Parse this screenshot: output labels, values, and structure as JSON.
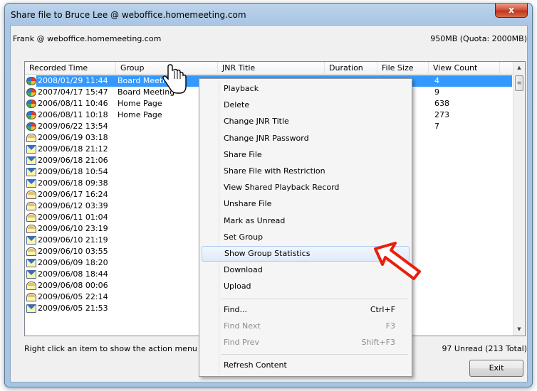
{
  "window": {
    "title": "Share file to Bruce Lee @ weboffice.homemeeting.com",
    "close_label": "x"
  },
  "header": {
    "user": "Frank @ weboffice.homemeeting.com",
    "quota": "950MB (Quota: 2000MB)"
  },
  "list": {
    "columns": [
      "Recorded Time",
      "Group",
      "JNR Title",
      "Duration",
      "File Size",
      "View Count"
    ],
    "rows": [
      {
        "time": "2008/01/29 11:44",
        "group": "Board Meetin",
        "views": "4",
        "icon": "color-icon",
        "selected": true
      },
      {
        "time": "2007/04/17 15:47",
        "group": "Board Meeting",
        "views": "9",
        "icon": "color-icon"
      },
      {
        "time": "2006/08/11 10:46",
        "group": "Home Page",
        "views": "638",
        "icon": "color-icon"
      },
      {
        "time": "2006/08/11 10:18",
        "group": "Home Page",
        "views": "273",
        "icon": "color-icon"
      },
      {
        "time": "2009/06/22 13:54",
        "group": "",
        "views": "7",
        "icon": "color-icon"
      },
      {
        "time": "2009/06/19 03:18",
        "group": "",
        "views": "",
        "icon": "open-envelope-icon"
      },
      {
        "time": "2009/06/18 21:12",
        "group": "",
        "views": "",
        "icon": "envelope-icon"
      },
      {
        "time": "2009/06/18 21:06",
        "group": "",
        "views": "",
        "icon": "envelope-icon"
      },
      {
        "time": "2009/06/18 10:54",
        "group": "",
        "views": "",
        "icon": "envelope-icon"
      },
      {
        "time": "2009/06/18 09:38",
        "group": "",
        "views": "",
        "icon": "envelope-icon"
      },
      {
        "time": "2009/06/17 16:24",
        "group": "",
        "views": "",
        "icon": "open-envelope-icon"
      },
      {
        "time": "2009/06/12 03:39",
        "group": "",
        "views": "",
        "icon": "open-envelope-icon"
      },
      {
        "time": "2009/06/11 01:04",
        "group": "",
        "views": "",
        "icon": "open-envelope-icon"
      },
      {
        "time": "2009/06/10 23:19",
        "group": "",
        "views": "",
        "icon": "open-envelope-icon"
      },
      {
        "time": "2009/06/10 21:19",
        "group": "",
        "views": "",
        "icon": "envelope-icon"
      },
      {
        "time": "2009/06/10 03:55",
        "group": "",
        "views": "",
        "icon": "open-envelope-icon"
      },
      {
        "time": "2009/06/09 18:20",
        "group": "",
        "views": "",
        "icon": "envelope-icon"
      },
      {
        "time": "2009/06/08 18:44",
        "group": "",
        "views": "",
        "icon": "envelope-icon"
      },
      {
        "time": "2009/06/08 00:06",
        "group": "",
        "views": "",
        "icon": "open-envelope-icon"
      },
      {
        "time": "2009/06/05 22:14",
        "group": "",
        "views": "",
        "icon": "open-envelope-icon"
      },
      {
        "time": "2009/06/05 21:53",
        "group": "",
        "views": "",
        "icon": "envelope-icon"
      }
    ]
  },
  "context_menu": {
    "items": [
      {
        "label": "Playback",
        "shortcut": ""
      },
      {
        "label": "Delete",
        "shortcut": ""
      },
      {
        "label": "Change JNR Title",
        "shortcut": ""
      },
      {
        "label": "Change JNR Password",
        "shortcut": ""
      },
      {
        "label": "Share File",
        "shortcut": ""
      },
      {
        "label": "Share File with Restriction",
        "shortcut": ""
      },
      {
        "label": "View Shared Playback Record",
        "shortcut": ""
      },
      {
        "label": "Unshare File",
        "shortcut": ""
      },
      {
        "label": "Mark as Unread",
        "shortcut": ""
      },
      {
        "label": "Set Group",
        "shortcut": ""
      },
      {
        "label": "Show Group Statistics",
        "shortcut": "",
        "highlighted": true
      },
      {
        "label": "Download",
        "shortcut": ""
      },
      {
        "label": "Upload",
        "shortcut": ""
      },
      {
        "separator": true
      },
      {
        "label": "Find...",
        "shortcut": "Ctrl+F"
      },
      {
        "label": "Find Next",
        "shortcut": "F3",
        "disabled": true
      },
      {
        "label": "Find Prev",
        "shortcut": "Shift+F3",
        "disabled": true
      },
      {
        "separator": true
      },
      {
        "label": "Refresh Content",
        "shortcut": ""
      }
    ]
  },
  "status": {
    "hint": "Right click an item to show the action menu",
    "unread": "97 Unread (213 Total)"
  },
  "buttons": {
    "exit": "Exit"
  },
  "colors": {
    "selection": "#3399ff",
    "annotation_arrow": "#e8200c",
    "title_gradient": "#a9c6e4"
  }
}
